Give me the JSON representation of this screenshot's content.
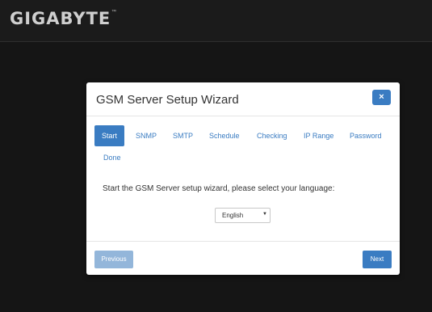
{
  "brand": {
    "logo_text": "GIGABYTE",
    "trademark": "™"
  },
  "modal": {
    "title": "GSM Server Setup Wizard",
    "close_label": "×",
    "tabs": [
      {
        "label": "Start",
        "active": true
      },
      {
        "label": "SNMP",
        "active": false
      },
      {
        "label": "SMTP",
        "active": false
      },
      {
        "label": "Schedule",
        "active": false
      },
      {
        "label": "Checking",
        "active": false
      },
      {
        "label": "IP Range",
        "active": false
      },
      {
        "label": "Password",
        "active": false
      },
      {
        "label": "Done",
        "active": false
      }
    ],
    "prompt": "Start the GSM Server setup wizard, please select your language:",
    "language": {
      "selected": "English",
      "caret": "▼"
    },
    "footer": {
      "previous_label": "Previous",
      "next_label": "Next"
    }
  },
  "colors": {
    "accent": "#3a7cc2",
    "disabled_button": "#93b6da",
    "background": "#151515"
  }
}
